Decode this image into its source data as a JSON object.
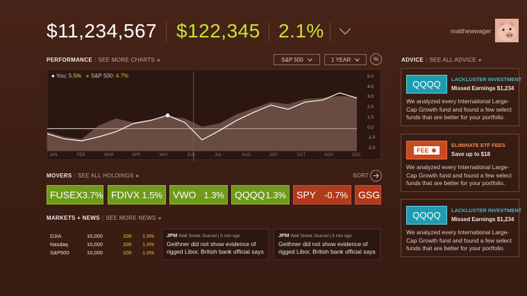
{
  "header": {
    "balance": "$11,234,567",
    "gain": "$122,345",
    "gain_pct": "2.1%",
    "username": "matthewwager"
  },
  "performance": {
    "title": "PERFORMANCE",
    "link": "SEE MORE CHARTS",
    "benchmark_select": "S&P 500",
    "period_select": "1 YEAR",
    "pct_button": "%",
    "legend": {
      "you_label": "You:",
      "you_value": "5.5%",
      "sp_label": "S&P 500:",
      "sp_value": "4.7%"
    },
    "y_ticks": [
      "5.0",
      "4.0",
      "3.0",
      "2.0",
      "1.0",
      "0.0",
      "-1.0",
      "-2.0"
    ],
    "x_ticks": [
      "JAN",
      "FEB",
      "MAR",
      "APR",
      "MAY",
      "JUN",
      "JUL",
      "AUG",
      "SEP",
      "OCT",
      "NOV",
      "DEC"
    ]
  },
  "chart_data": {
    "type": "line",
    "title": "",
    "xlabel": "",
    "ylabel": "",
    "ylim": [
      -2.2,
      5.2
    ],
    "grid": false,
    "legend_position": "top-left",
    "categories": [
      "JAN",
      "FEB",
      "MAR",
      "APR",
      "MAY",
      "JUN",
      "JUL",
      "AUG",
      "SEP",
      "OCT",
      "NOV",
      "DEC"
    ],
    "series": [
      {
        "name": "You",
        "color": "#ffffff",
        "values": [
          -0.5,
          -1.0,
          -1.2,
          -0.8,
          -0.3,
          0.5,
          0.8,
          1.3,
          0.6,
          -1.1,
          -0.2,
          0.8,
          1.6,
          2.3,
          1.9,
          2.6,
          2.8,
          3.5,
          3.0
        ]
      },
      {
        "name": "S&P 500",
        "color": "#9b7a6a",
        "values": [
          -0.3,
          -0.8,
          -1.0,
          0.3,
          1.0,
          0.6,
          0.9,
          1.2,
          1.0,
          0.2,
          0.5,
          1.4,
          2.0,
          2.6,
          2.4,
          2.9,
          3.0,
          3.2,
          3.1
        ]
      }
    ],
    "highlight_point": {
      "series": "You",
      "month": "JUL/AUG",
      "value": 0.8
    }
  },
  "movers": {
    "title": "MOVERS",
    "link": "SEE ALL HOLDINGS",
    "sort_label": "SORT",
    "items": [
      {
        "ticker": "FUSEX",
        "change": "3.7%",
        "color": "green"
      },
      {
        "ticker": "FDIVX",
        "change": "1.5%",
        "color": "green"
      },
      {
        "ticker": "VWO",
        "change": "1.3%",
        "color": "green"
      },
      {
        "ticker": "QQQQ",
        "change": "1.3%",
        "color": "green"
      },
      {
        "ticker": "SPY",
        "change": "-0.7%",
        "color": "red"
      },
      {
        "ticker": "GSG",
        "change": "",
        "color": "red"
      }
    ]
  },
  "markets": {
    "title": "MARKETS + NEWS",
    "link": "SEE MORE NEWS",
    "rows": [
      {
        "name": "DJIA",
        "value": "10,000",
        "change": "100",
        "pct": "1.0%"
      },
      {
        "name": "Nasdaq",
        "value": "10,000",
        "change": "100",
        "pct": "1.0%"
      },
      {
        "name": "S&P500",
        "value": "10,000",
        "change": "100",
        "pct": "1.0%"
      }
    ],
    "news": [
      {
        "ticker": "JPM",
        "source": "Wall Street Journal | 5 min ago",
        "headline": "Geithner did not show evidence of rigged Libor, British bank official says"
      },
      {
        "ticker": "JPM",
        "source": "Wall Street Journal | 5 min ago",
        "headline": "Geithner did not show evidence of rigged Libor, British bank official says"
      }
    ]
  },
  "advice": {
    "title": "ADVICE",
    "link": "SEE ALL ADVICE",
    "cards": [
      {
        "logo": "QQQQ",
        "title": "LACKLUSTER INVESTMENT",
        "subtitle": "Missed Earnings $1,234",
        "body": "We analyzed every International Large-Cap Growth fund and found a few select funds that are better for your portfolio."
      },
      {
        "logo": "FEE",
        "title": "ELIMINATE ETF FEES",
        "subtitle": "Save up to $18",
        "body": "We analyzed every International Large-Cap Growth fund and found a few select funds that are better for your portfolio."
      },
      {
        "logo": "QQQQ",
        "title": "LACKLUSTER INVESTMENT",
        "subtitle": "Missed Earnings $1,234",
        "body": "We analyzed every International Large-Cap Growth fund and found a few select funds that are better for your portfolio."
      }
    ]
  },
  "colors": {
    "accent_lime": "#c7e23a",
    "mover_green": "#6f9a1b",
    "mover_red": "#b23a1d",
    "advice_teal": "#1f9bb0",
    "advice_orange": "#c94a22"
  }
}
